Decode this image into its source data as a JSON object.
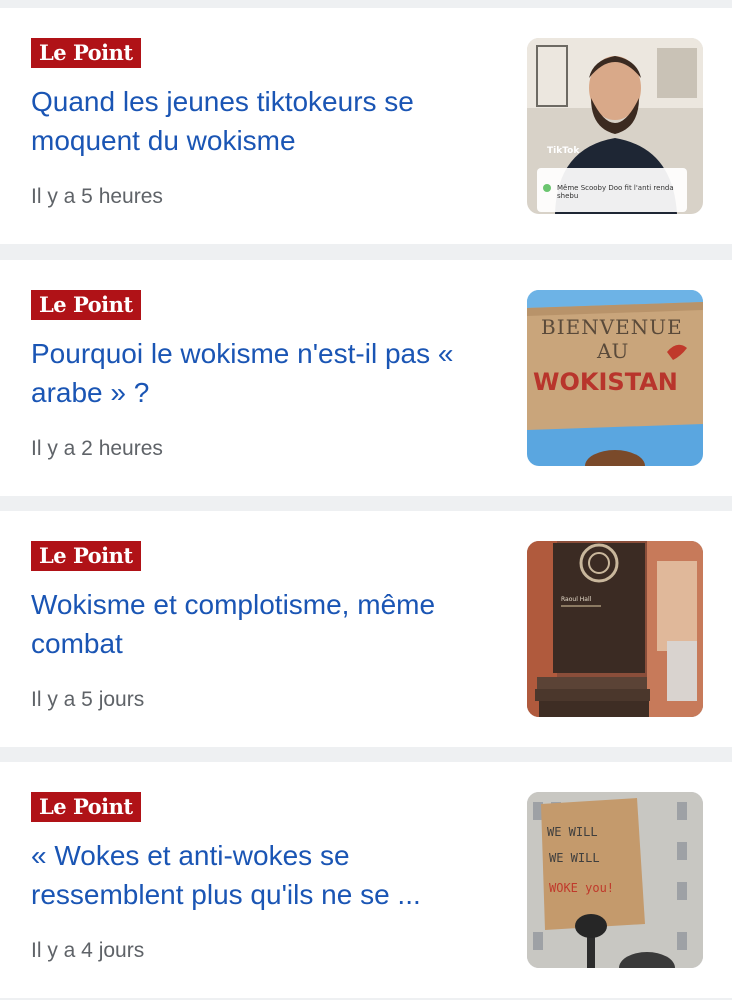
{
  "articles": [
    {
      "source": "Le Point",
      "headline": "Quand les jeunes tiktokeurs se moquent du wokisme",
      "time": "Il y a 5 heures",
      "thumbnail_icon": "tiktok-man-thumbnail",
      "thumbnail_text": [
        "TikTok",
        "Même Scooby Doo fit l'anti renda shebu"
      ]
    },
    {
      "source": "Le Point",
      "headline": "Pourquoi le wokisme n'est-il pas « arabe » ?",
      "time": "Il y a 2 heures",
      "thumbnail_icon": "protest-sign-thumbnail",
      "thumbnail_text": [
        "BIENVENUE",
        "AU",
        "WOKISTAN"
      ]
    },
    {
      "source": "Le Point",
      "headline": "Wokisme et complotisme, même combat",
      "time": "Il y a 5 jours",
      "thumbnail_icon": "book-thumbnail",
      "thumbnail_text": [
        "Raoul Hall"
      ]
    },
    {
      "source": "Le Point",
      "headline": "« Wokes et anti-wokes se ressemblent plus qu'ils ne se ...",
      "time": "Il y a 4 jours",
      "thumbnail_icon": "protest-placard-thumbnail",
      "thumbnail_text": [
        "WE WILL",
        "WE WILL",
        "WOKE you!"
      ]
    }
  ],
  "colors": {
    "headline": "#1a55b4",
    "source_badge": "#b01217",
    "timestamp": "#5f6368",
    "card_background": "#ffffff",
    "page_background": "#eef0f2"
  }
}
